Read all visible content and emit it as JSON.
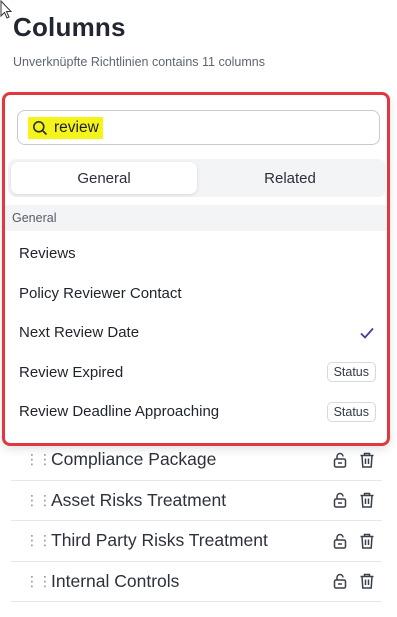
{
  "header": {
    "title": "Columns",
    "subtitle": "Unverknüpfte Richtlinien contains 11 columns"
  },
  "popup": {
    "search": {
      "value": "review"
    },
    "tabs": [
      {
        "label": "General",
        "active": true
      },
      {
        "label": "Related",
        "active": false
      }
    ],
    "section_label": "General",
    "options": [
      {
        "label": "Reviews",
        "badge": null,
        "checked": false
      },
      {
        "label": "Policy Reviewer Contact",
        "badge": null,
        "checked": false
      },
      {
        "label": "Next Review Date",
        "badge": null,
        "checked": true
      },
      {
        "label": "Review Expired",
        "badge": "Status",
        "checked": false
      },
      {
        "label": "Review Deadline Approaching",
        "badge": "Status",
        "checked": false
      }
    ]
  },
  "columns": [
    {
      "label": "Compliance Package"
    },
    {
      "label": "Asset Risks Treatment"
    },
    {
      "label": "Third Party Risks Treatment"
    },
    {
      "label": "Internal Controls"
    }
  ],
  "colors": {
    "highlight": "#f4f41a",
    "popup_border": "#e0383e",
    "check": "#3b3f9e"
  },
  "icons": {
    "search": "search-icon",
    "drag": "drag-handle-icon",
    "unlock": "unlock-icon",
    "delete": "trash-icon",
    "check": "check-icon",
    "cursor": "mouse-cursor-icon"
  }
}
